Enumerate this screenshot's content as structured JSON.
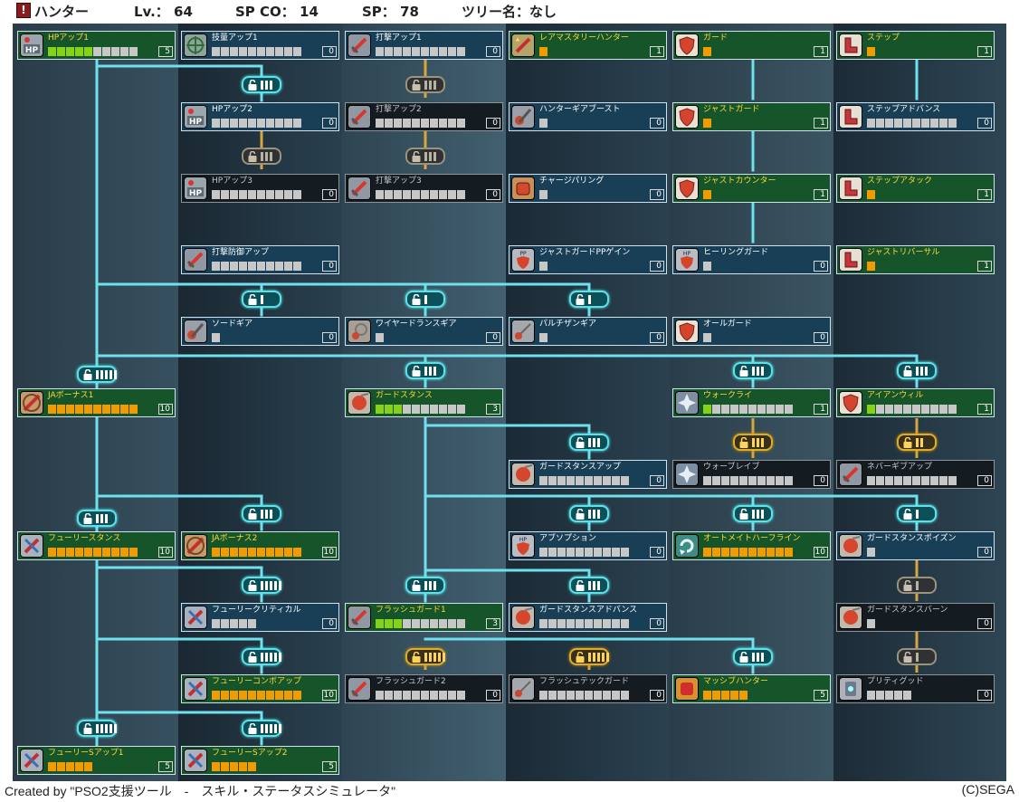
{
  "header": {
    "class_name": "ハンター",
    "level": "Lv.： 64",
    "sp_co": "SP CO： 14",
    "sp": "SP： 78",
    "tree_name": "ツリー名：なし"
  },
  "colors": {
    "node_blue": "#183f56",
    "node_green": "#16542a",
    "node_dark": "#141b21",
    "connector": "#6fe1ee",
    "connector_gold": "#d9a63a",
    "bar_green": "#86d219",
    "bar_orange": "#f29b00",
    "bar_empty": "#c7c7c7"
  },
  "skills": [
    {
      "id": "hp-up-1",
      "name": "HPアップ1",
      "icon": "hp-icon",
      "state": "green",
      "pips": 10,
      "filled": 5,
      "fill": "g",
      "level": "5"
    },
    {
      "id": "tech-up-1",
      "name": "技量アップ1",
      "icon": "crosshair-icon",
      "state": "blue",
      "pips": 10,
      "filled": 0,
      "fill": "g",
      "level": "0"
    },
    {
      "id": "strike-up-1",
      "name": "打撃アップ1",
      "icon": "sword-icon",
      "state": "blue",
      "pips": 10,
      "filled": 0,
      "fill": "g",
      "level": "0"
    },
    {
      "id": "rare-mastery-hunter",
      "name": "レアマスタリーハンター",
      "icon": "star-sword-icon",
      "state": "green",
      "pips": 1,
      "filled": 1,
      "fill": "o",
      "level": "1"
    },
    {
      "id": "guard",
      "name": "ガード",
      "icon": "shield-icon",
      "state": "green",
      "pips": 1,
      "filled": 1,
      "fill": "o",
      "level": "1"
    },
    {
      "id": "step",
      "name": "ステップ",
      "icon": "boot-icon",
      "state": "green",
      "pips": 1,
      "filled": 1,
      "fill": "o",
      "level": "1"
    },
    {
      "id": "hp-up-2",
      "name": "HPアップ2",
      "icon": "hp-icon",
      "state": "blue",
      "pips": 10,
      "filled": 0,
      "fill": "g",
      "level": "0"
    },
    {
      "id": "strike-up-2",
      "name": "打撃アップ2",
      "icon": "sword-icon",
      "state": "dark",
      "pips": 10,
      "filled": 0,
      "fill": "g",
      "level": "0"
    },
    {
      "id": "hunter-gear-boost",
      "name": "ハンターギアブースト",
      "icon": "gear-sword-icon",
      "state": "blue",
      "pips": 1,
      "filled": 0,
      "fill": "o",
      "level": "0"
    },
    {
      "id": "just-guard",
      "name": "ジャストガード",
      "icon": "shield-icon",
      "state": "green",
      "pips": 1,
      "filled": 1,
      "fill": "o",
      "level": "1"
    },
    {
      "id": "step-advance",
      "name": "ステップアドバンス",
      "icon": "boot-icon",
      "state": "blue",
      "pips": 10,
      "filled": 0,
      "fill": "g",
      "level": "0"
    },
    {
      "id": "hp-up-3",
      "name": "HPアップ3",
      "icon": "hp-icon",
      "state": "dark",
      "pips": 10,
      "filled": 0,
      "fill": "g",
      "level": "0"
    },
    {
      "id": "strike-up-3",
      "name": "打撃アップ3",
      "icon": "sword-icon",
      "state": "dark",
      "pips": 10,
      "filled": 0,
      "fill": "g",
      "level": "0"
    },
    {
      "id": "charge-parry",
      "name": "チャージパリング",
      "icon": "fist-icon",
      "state": "blue",
      "pips": 1,
      "filled": 0,
      "fill": "o",
      "level": "0"
    },
    {
      "id": "just-counter",
      "name": "ジャストカウンター",
      "icon": "shield-icon",
      "state": "green",
      "pips": 1,
      "filled": 1,
      "fill": "o",
      "level": "1"
    },
    {
      "id": "step-attack",
      "name": "ステップアタック",
      "icon": "boot-icon",
      "state": "green",
      "pips": 1,
      "filled": 1,
      "fill": "o",
      "level": "1"
    },
    {
      "id": "strike-defense-up",
      "name": "打撃防御アップ",
      "icon": "sword-icon",
      "state": "blue",
      "pips": 10,
      "filled": 0,
      "fill": "g",
      "level": "0"
    },
    {
      "id": "just-guard-pp-gain",
      "name": "ジャストガードPPゲイン",
      "icon": "pp-shield-icon",
      "state": "blue",
      "pips": 1,
      "filled": 0,
      "fill": "o",
      "level": "0"
    },
    {
      "id": "healing-guard",
      "name": "ヒーリングガード",
      "icon": "hp-shield-icon",
      "state": "blue",
      "pips": 1,
      "filled": 0,
      "fill": "o",
      "level": "0"
    },
    {
      "id": "step-reversal",
      "name": "ジャストリバーサル",
      "icon": "boot-icon",
      "state": "green",
      "pips": 1,
      "filled": 1,
      "fill": "o",
      "level": "1"
    },
    {
      "id": "sword-gear",
      "name": "ソードギア",
      "icon": "gear-sword-icon",
      "state": "blue",
      "pips": 1,
      "filled": 0,
      "fill": "o",
      "level": "0"
    },
    {
      "id": "wired-lance-gear",
      "name": "ワイヤードランスギア",
      "icon": "gear-lance-icon",
      "state": "blue",
      "pips": 1,
      "filled": 0,
      "fill": "o",
      "level": "0"
    },
    {
      "id": "partisan-gear",
      "name": "パルチザンギア",
      "icon": "gear-partisan-icon",
      "state": "blue",
      "pips": 1,
      "filled": 0,
      "fill": "o",
      "level": "0"
    },
    {
      "id": "all-guard",
      "name": "オールガード",
      "icon": "shield-icon",
      "state": "blue",
      "pips": 1,
      "filled": 0,
      "fill": "o",
      "level": "0"
    },
    {
      "id": "ja-bonus-1",
      "name": "JAボーナス1",
      "icon": "ja-icon",
      "state": "green",
      "pips": 10,
      "filled": 10,
      "fill": "o",
      "level": "10"
    },
    {
      "id": "guard-stance",
      "name": "ガードスタンス",
      "icon": "stance-icon",
      "state": "green",
      "pips": 10,
      "filled": 3,
      "fill": "g",
      "level": "3"
    },
    {
      "id": "war-cry",
      "name": "ウォークライ",
      "icon": "warcry-icon",
      "state": "green",
      "pips": 10,
      "filled": 1,
      "fill": "g",
      "level": "1"
    },
    {
      "id": "iron-will",
      "name": "アイアンウィル",
      "icon": "shield-icon",
      "state": "green",
      "pips": 10,
      "filled": 1,
      "fill": "g",
      "level": "1"
    },
    {
      "id": "guard-stance-up",
      "name": "ガードスタンスアップ",
      "icon": "stance-icon",
      "state": "blue",
      "pips": 10,
      "filled": 0,
      "fill": "g",
      "level": "0"
    },
    {
      "id": "war-brave",
      "name": "ウォーブレイブ",
      "icon": "warcry-icon",
      "state": "dark",
      "pips": 10,
      "filled": 0,
      "fill": "g",
      "level": "0"
    },
    {
      "id": "never-give-up",
      "name": "ネバーギブアップ",
      "icon": "sword-icon",
      "state": "dark",
      "pips": 10,
      "filled": 0,
      "fill": "g",
      "level": "0"
    },
    {
      "id": "fury-stance",
      "name": "フューリースタンス",
      "icon": "fury-icon",
      "state": "green",
      "pips": 10,
      "filled": 10,
      "fill": "o",
      "level": "10"
    },
    {
      "id": "ja-bonus-2",
      "name": "JAボーナス2",
      "icon": "ja-icon",
      "state": "green",
      "pips": 10,
      "filled": 10,
      "fill": "o",
      "level": "10"
    },
    {
      "id": "absorption",
      "name": "アブソプション",
      "icon": "hp-shield-icon",
      "state": "blue",
      "pips": 10,
      "filled": 0,
      "fill": "g",
      "level": "0"
    },
    {
      "id": "automate-halfline",
      "name": "オートメイトハーフライン",
      "icon": "automate-icon",
      "state": "green",
      "pips": 10,
      "filled": 10,
      "fill": "o",
      "level": "10"
    },
    {
      "id": "guard-stance-poison",
      "name": "ガードスタンスポイズン",
      "icon": "stance-icon",
      "state": "blue",
      "pips": 1,
      "filled": 0,
      "fill": "o",
      "level": "0"
    },
    {
      "id": "fury-critical",
      "name": "フューリークリティカル",
      "icon": "fury-icon",
      "state": "blue",
      "pips": 5,
      "filled": 0,
      "fill": "g",
      "level": "0"
    },
    {
      "id": "flash-guard-1",
      "name": "フラッシュガード1",
      "icon": "sword-icon",
      "state": "green",
      "pips": 10,
      "filled": 3,
      "fill": "g",
      "level": "3"
    },
    {
      "id": "guard-stance-advance",
      "name": "ガードスタンスアドバンス",
      "icon": "stance-icon",
      "state": "blue",
      "pips": 10,
      "filled": 0,
      "fill": "g",
      "level": "0"
    },
    {
      "id": "guard-stance-burn",
      "name": "ガードスタンスバーン",
      "icon": "stance-icon",
      "state": "dark",
      "pips": 1,
      "filled": 0,
      "fill": "o",
      "level": "0"
    },
    {
      "id": "fury-combo-up",
      "name": "フューリーコンボアップ",
      "icon": "fury-icon",
      "state": "green",
      "pips": 10,
      "filled": 10,
      "fill": "o",
      "level": "10"
    },
    {
      "id": "flash-guard-2",
      "name": "フラッシュガード2",
      "icon": "sword-icon",
      "state": "dark",
      "pips": 10,
      "filled": 0,
      "fill": "g",
      "level": "0"
    },
    {
      "id": "flash-tech-guard",
      "name": "フラッシュテックガード",
      "icon": "gear-partisan-icon",
      "state": "dark",
      "pips": 10,
      "filled": 0,
      "fill": "g",
      "level": "0"
    },
    {
      "id": "massive-hunter",
      "name": "マッシブハンター",
      "icon": "massive-icon",
      "state": "green",
      "pips": 5,
      "filled": 5,
      "fill": "o",
      "level": "5"
    },
    {
      "id": "purity-good",
      "name": "プリティグッド",
      "icon": "tech-icon",
      "state": "dark",
      "pips": 5,
      "filled": 0,
      "fill": "g",
      "level": "0"
    },
    {
      "id": "fury-s-up-1",
      "name": "フューリーSアップ1",
      "icon": "fury-icon",
      "state": "green",
      "pips": 5,
      "filled": 5,
      "fill": "o",
      "level": "5"
    },
    {
      "id": "fury-s-up-2",
      "name": "フューリーSアップ2",
      "icon": "fury-icon",
      "state": "green",
      "pips": 5,
      "filled": 5,
      "fill": "o",
      "level": "5"
    }
  ],
  "locks": [
    {
      "id": "lock-hp2",
      "ticks": 3,
      "state": "on"
    },
    {
      "id": "lock-strike2",
      "ticks": 3,
      "state": "dim"
    },
    {
      "id": "lock-hp3",
      "ticks": 3,
      "state": "dim"
    },
    {
      "id": "lock-strike3",
      "ticks": 3,
      "state": "dim"
    },
    {
      "id": "lock-sword-gear",
      "ticks": 1,
      "state": "on"
    },
    {
      "id": "lock-wired-gear",
      "ticks": 1,
      "state": "on"
    },
    {
      "id": "lock-partisan-gear",
      "ticks": 1,
      "state": "on"
    },
    {
      "id": "lock-ja1",
      "ticks": 5,
      "state": "on"
    },
    {
      "id": "lock-guard-stance",
      "ticks": 3,
      "state": "on"
    },
    {
      "id": "lock-war-cry",
      "ticks": 3,
      "state": "on"
    },
    {
      "id": "lock-iron-will",
      "ticks": 3,
      "state": "on"
    },
    {
      "id": "lock-gs-up",
      "ticks": 3,
      "state": "on"
    },
    {
      "id": "lock-war-brave",
      "ticks": 3,
      "state": "gold"
    },
    {
      "id": "lock-never-give",
      "ticks": 2,
      "state": "gold"
    },
    {
      "id": "lock-fury-stance",
      "ticks": 3,
      "state": "on"
    },
    {
      "id": "lock-ja2",
      "ticks": 3,
      "state": "on"
    },
    {
      "id": "lock-absorption",
      "ticks": 3,
      "state": "on"
    },
    {
      "id": "lock-automate",
      "ticks": 3,
      "state": "on"
    },
    {
      "id": "lock-gs-poison",
      "ticks": 1,
      "state": "on"
    },
    {
      "id": "lock-fury-critical",
      "ticks": 5,
      "state": "on"
    },
    {
      "id": "lock-flash1",
      "ticks": 3,
      "state": "on"
    },
    {
      "id": "lock-gs-advance",
      "ticks": 3,
      "state": "on"
    },
    {
      "id": "lock-gs-burn",
      "ticks": 1,
      "state": "dim"
    },
    {
      "id": "lock-fury-combo",
      "ticks": 5,
      "state": "on"
    },
    {
      "id": "lock-flash2",
      "ticks": 5,
      "state": "gold"
    },
    {
      "id": "lock-flash-tech",
      "ticks": 5,
      "state": "gold"
    },
    {
      "id": "lock-massive",
      "ticks": 3,
      "state": "on"
    },
    {
      "id": "lock-purity",
      "ticks": 1,
      "state": "dim"
    },
    {
      "id": "lock-fury-s1",
      "ticks": 5,
      "state": "on"
    },
    {
      "id": "lock-fury-s2",
      "ticks": 5,
      "state": "on"
    }
  ],
  "footer": {
    "credit": "Created by \"PSO2支援ツール　-　スキル・ステータスシミュレータ\"",
    "copyright": "(C)SEGA"
  }
}
